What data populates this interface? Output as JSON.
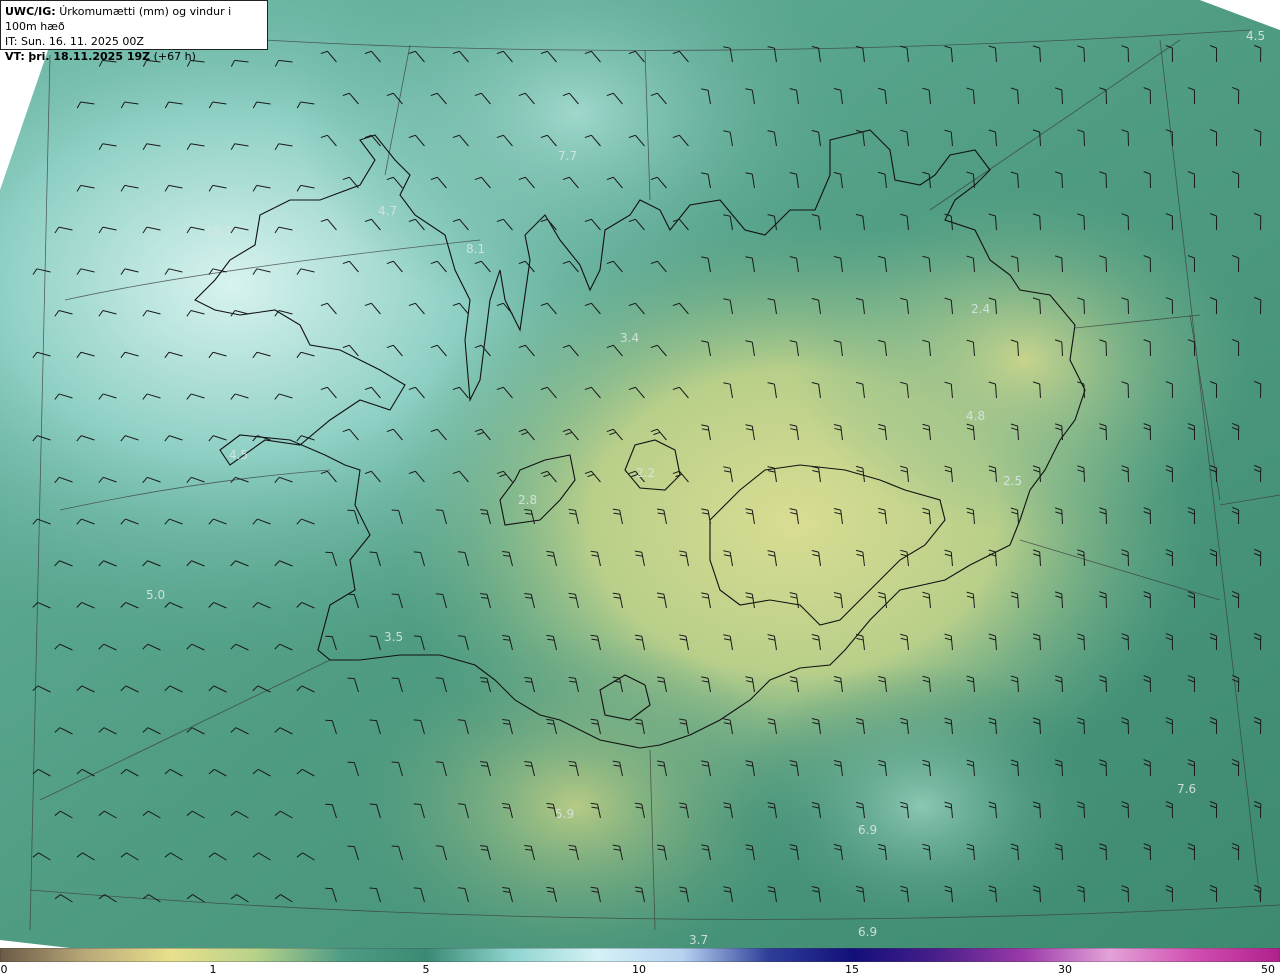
{
  "header": {
    "line1_prefix": "UWC/IG:",
    "line1_text": "Úrkomumætti (mm) og vindur i 100m hæð",
    "line2": "IT: Sun. 16. 11. 2025 00Z",
    "line3_prefix": "VT:",
    "line3_text": "þri. 18.11.2025 19Z",
    "line3_suffix": "(+67 h)"
  },
  "map_labels": [
    "7.7",
    "4.7",
    "10.2",
    "8.1",
    "3.4",
    "2.4",
    "4.8",
    "4.5",
    "2.8",
    "2.2",
    "2.5",
    "5.0",
    "3.5",
    "5.9",
    "6.9",
    "6.9",
    "3.7",
    "7.6",
    "4.5"
  ],
  "colorbar": {
    "ticks": [
      "0",
      "1",
      "5",
      "10",
      "15",
      "30",
      "50"
    ],
    "colors": [
      "#6b5a46",
      "#b9a878",
      "#e9e08c",
      "#b6d28a",
      "#4f9c86",
      "#3a8a74",
      "#8fd4cf",
      "#d4f2f6",
      "#b5d2f0",
      "#2f3f9a",
      "#120f7a",
      "#4a1f8c",
      "#9a3aa8",
      "#e3a2d8",
      "#d04fb0",
      "#b0208c"
    ]
  }
}
